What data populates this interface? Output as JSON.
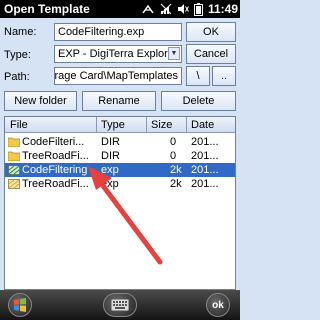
{
  "window": {
    "title": "Open Template",
    "time": "11:49"
  },
  "form": {
    "name_label": "Name:",
    "name_value": "CodeFiltering.exp",
    "ok_label": "OK",
    "type_label": "Type:",
    "type_value": "EXP - DigiTerra Explorer",
    "cancel_label": "Cancel",
    "path_label": "Path:",
    "path_value": "Storage Card\\MapTemplates",
    "backslash_label": "\\",
    "dotdot_label": ".."
  },
  "actions": {
    "new_folder_label": "New folder",
    "rename_label": "Rename",
    "delete_label": "Delete"
  },
  "list": {
    "columns": [
      "File",
      "Type",
      "Size",
      "Date"
    ],
    "rows": [
      {
        "name": "CodeFilteri...",
        "type": "DIR",
        "size": "0",
        "date": "201...",
        "icon": "folder-icon",
        "selected": false
      },
      {
        "name": "TreeRoadFi...",
        "type": "DIR",
        "size": "0",
        "date": "201...",
        "icon": "folder-icon",
        "selected": false
      },
      {
        "name": "CodeFiltering",
        "type": "exp",
        "size": "2k",
        "date": "201...",
        "icon": "template-file-icon",
        "selected": true
      },
      {
        "name": "TreeRoadFi...",
        "type": "exp",
        "size": "2k",
        "date": "201...",
        "icon": "template-file-icon",
        "selected": false
      }
    ]
  },
  "softkeys": {
    "ok_label": "ok",
    "start_icon": "windows-start-icon",
    "keyboard_icon": "keyboard-icon"
  },
  "colors": {
    "selection": "#316ac5",
    "annotation_arrow": "#e8413c",
    "background": "#d6e3f5"
  }
}
